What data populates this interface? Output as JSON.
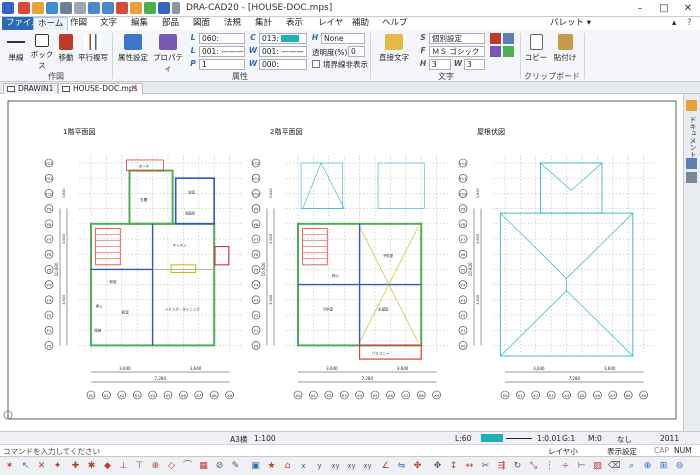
{
  "window": {
    "title": "DRA-CAD20 - [HOUSE-DOC.mps]",
    "controls": [
      "–",
      "□",
      "✕"
    ]
  },
  "menu": {
    "items": [
      "ファイル",
      "ホーム",
      "作図",
      "文字",
      "編集",
      "部品",
      "図面",
      "法規",
      "集計",
      "表示",
      "レイヤ",
      "補助",
      "ヘルプ"
    ],
    "palette": "パレット"
  },
  "ribbon": {
    "groups": {
      "sakuzu": "作図",
      "zokusei": "属性",
      "moji": "文字",
      "clipboard": "クリップボード"
    },
    "buttons": {
      "tansen": "単線",
      "box": "ボックス",
      "idou": "移動",
      "heiko": "平行複写",
      "zokusei_settei": "属性設定",
      "property": "プロパティ",
      "chokusetsu": "直接文字",
      "copy": "コピー",
      "paste": "貼付け"
    },
    "fields": {
      "layer": "060:",
      "color": "013:",
      "linetype": "001:",
      "hatch": "None",
      "width": "000:",
      "pen": "1",
      "transparency_label": "透明度(%)",
      "transparency": "0",
      "boundary_label": "境界線非表示",
      "font_setting": "個別設定",
      "font_name": "ＭＳ ゴシック",
      "font_h": "3",
      "font_w": "3"
    }
  },
  "tabs": {
    "drawing1": "DRAWIN1",
    "house": "HOUSE-DOC.mps"
  },
  "rightbar": {
    "label": "ドキュメント"
  },
  "drawing": {
    "titles": [
      "1階平面図",
      "2階平面図",
      "屋根伏図"
    ],
    "row_labels": [
      "Y12",
      "Y11",
      "Y10",
      "Y9",
      "Y8",
      "Y7",
      "Y6",
      "Y5",
      "Y4",
      "Y3",
      "Y2",
      "Y1",
      "Y0"
    ],
    "col_labels": [
      "X0",
      "X1",
      "X2",
      "X3",
      "X4",
      "X5",
      "X6",
      "X7",
      "X8",
      "X9"
    ],
    "dims": {
      "half": "3,640",
      "total": "7,280",
      "v_total": "10,920"
    },
    "rooms_1f": [
      "ポーチ",
      "玄関",
      "浴室",
      "洗面所",
      "キッチン",
      "和室",
      "押入",
      "和室",
      "リビング・ダイニング",
      "収納"
    ],
    "rooms_2f": [
      "子供室",
      "押入",
      "子供室",
      "主寝室",
      "バルコニー"
    ]
  },
  "status": {
    "scale": "A3横",
    "ratio": "1:100",
    "layer_label": "L:60",
    "scale2": "1:0.01",
    "gval": "G:1",
    "m": "M:0",
    "none": "なし",
    "year": "2011",
    "layer_small": "レイヤ小",
    "display": "表示設定",
    "caps": "CAP",
    "num": "NUM"
  },
  "command": {
    "placeholder": "コマンドを入力してください"
  },
  "colors": {
    "accent": "#2b6cb8",
    "wall_green": "#4caf50",
    "wall_blue": "#2f57c4",
    "roof_cyan": "#2fb5c8",
    "stair_red": "#e53935",
    "status_teal": "#20b0b5"
  }
}
